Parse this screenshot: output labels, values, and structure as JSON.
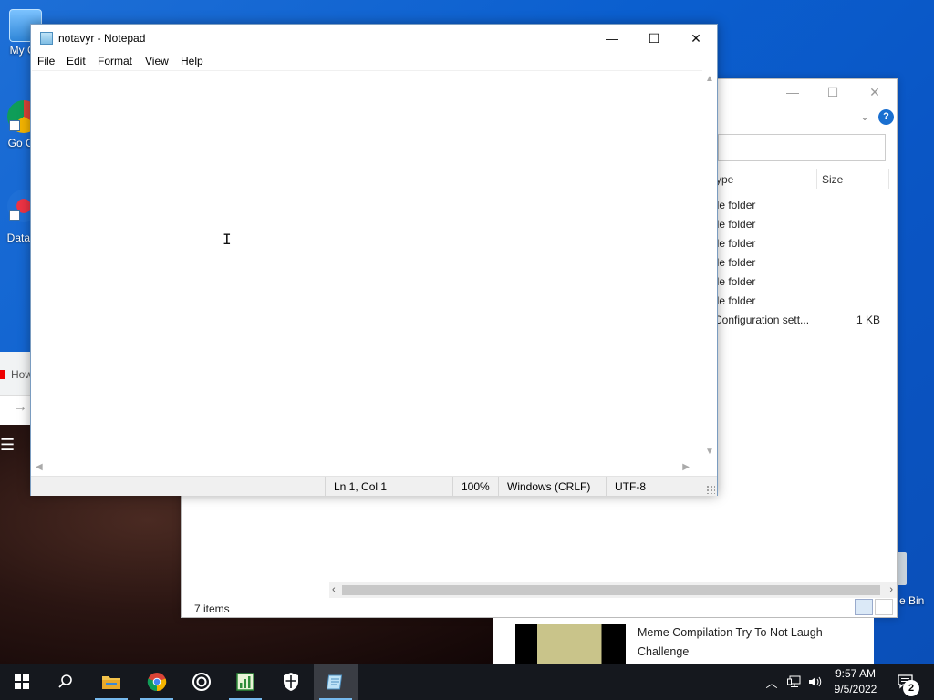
{
  "desktop": {
    "icons": [
      {
        "label": "My Co"
      },
      {
        "label": "Go Ch"
      },
      {
        "label": "DataW"
      }
    ],
    "recycle_label": "e Bin"
  },
  "background_browser": {
    "tab_text": "How"
  },
  "explorer": {
    "header_type": "ype",
    "header_size": "Size",
    "rows": [
      {
        "type": "ile folder",
        "size": ""
      },
      {
        "type": "ile folder",
        "size": ""
      },
      {
        "type": "ile folder",
        "size": ""
      },
      {
        "type": "ile folder",
        "size": ""
      },
      {
        "type": "ile folder",
        "size": ""
      },
      {
        "type": "ile folder",
        "size": ""
      },
      {
        "type": "Configuration sett...",
        "size": "1 KB"
      }
    ],
    "status": "7 items",
    "help_glyph": "?"
  },
  "notification": {
    "title": "Meme Compilation Try To Not Laugh Challenge"
  },
  "notepad": {
    "title": "notavyr - Notepad",
    "menu": [
      "File",
      "Edit",
      "Format",
      "View",
      "Help"
    ],
    "content": "",
    "status": {
      "position": "Ln 1, Col 1",
      "zoom": "100%",
      "line_ending": "Windows (CRLF)",
      "encoding": "UTF-8"
    }
  },
  "taskbar": {
    "time": "9:57 AM",
    "date": "9/5/2022",
    "notification_count": "2",
    "apps": [
      "start-icon",
      "search-icon",
      "file-explorer-icon",
      "chrome-icon",
      "target-icon",
      "spreadsheet-icon",
      "shield-icon",
      "notepad-icon"
    ]
  }
}
